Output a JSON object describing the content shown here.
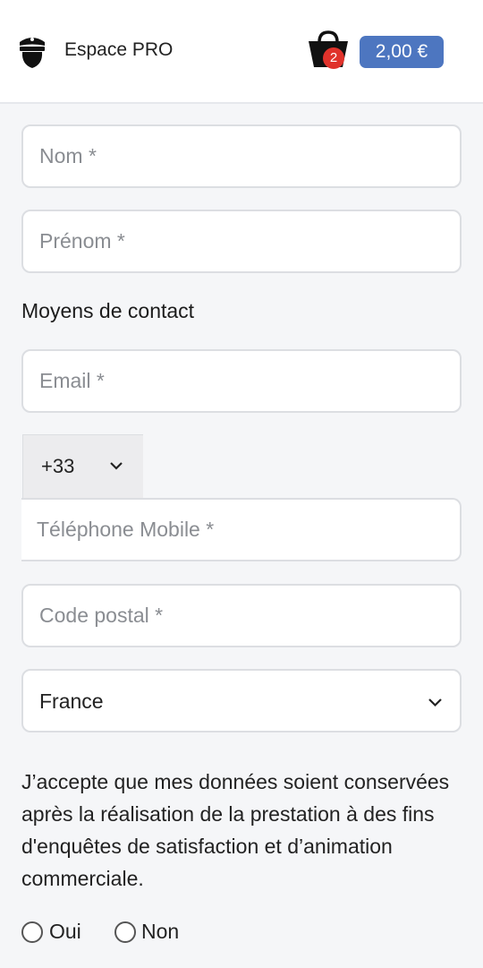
{
  "header": {
    "pro_label": "Espace PRO",
    "cart_count": "2",
    "total_price": "2,00 €"
  },
  "form": {
    "nom_placeholder": "Nom *",
    "prenom_placeholder": "Prénom *",
    "contact_section_label": "Moyens de contact",
    "email_placeholder": "Email *",
    "country_code": "+33",
    "phone_placeholder": "Téléphone Mobile *",
    "postal_placeholder": "Code postal *",
    "country": "France",
    "consent_text": "J’accepte que mes données soient conservées après la réalisation de la prestation à des fins d'enquêtes de satisfaction et d’animation commerciale.",
    "consent_yes": "Oui",
    "consent_no": "Non"
  },
  "colors": {
    "price_badge": "#4d76c0",
    "cart_badge": "#e0322b"
  }
}
